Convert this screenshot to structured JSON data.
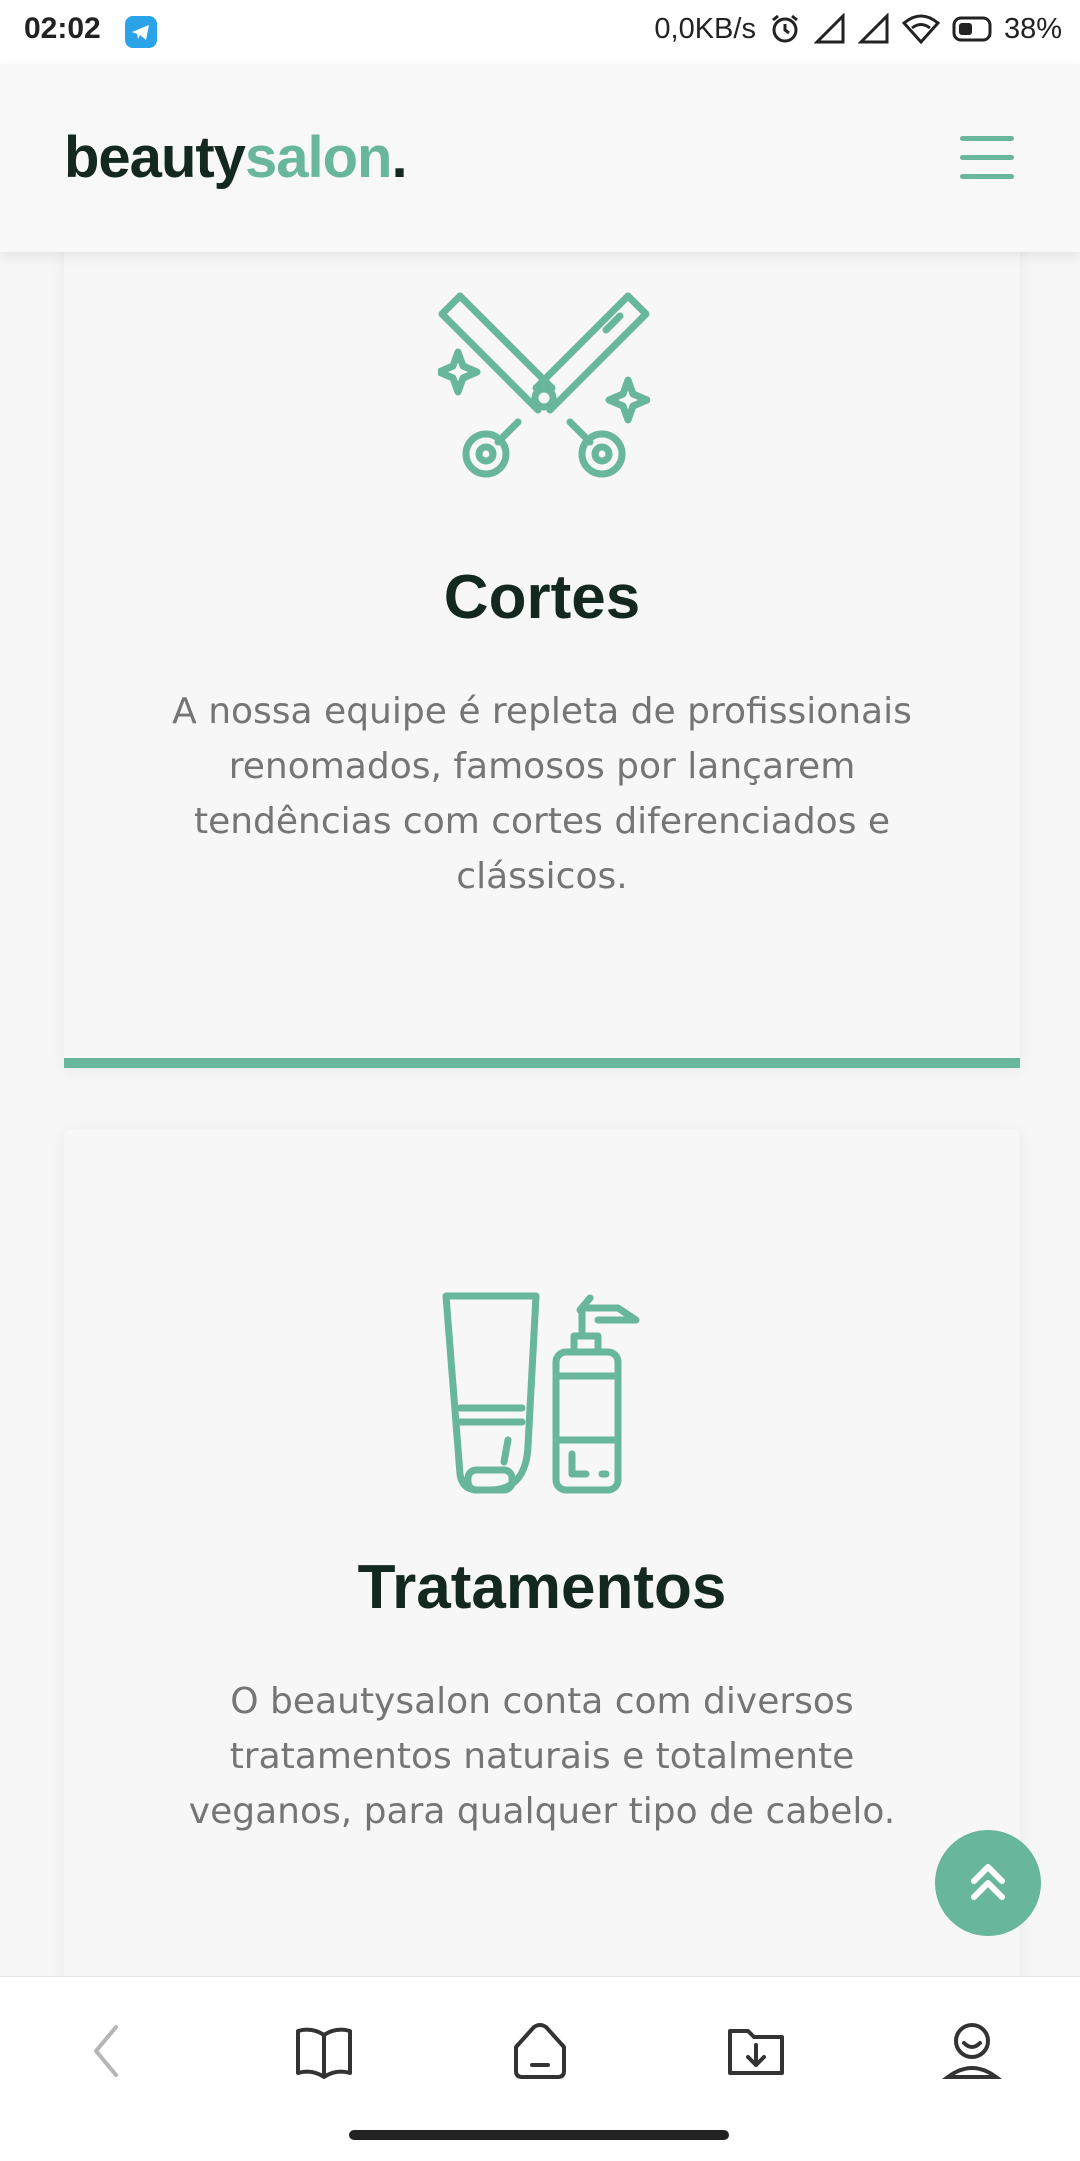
{
  "status_bar": {
    "time": "02:02",
    "net_speed": "0,0KB/s",
    "battery": "38%",
    "icons": [
      "telegram-icon",
      "alarm-icon",
      "signal-icon",
      "signal-icon",
      "wifi-icon",
      "battery-icon"
    ]
  },
  "header": {
    "logo_part1": "beauty",
    "logo_part2": "salon",
    "logo_part3": ".",
    "menu_icon": "hamburger-menu-icon"
  },
  "cards": [
    {
      "icon": "scissors-icon",
      "title": "Cortes",
      "text": "A nossa equipe é repleta de profissionais renomados, famosos por lançarem tendências com cortes diferenciados e clássicos."
    },
    {
      "icon": "hair-products-icon",
      "title": "Tratamentos",
      "text": "O beautysalon conta com diversos tratamentos naturais e totalmente veganos, para qualquer tipo de cabelo."
    }
  ],
  "scroll_top_icon": "double-chevron-up-icon",
  "bottom_nav": [
    "back-icon",
    "bookmarks-icon",
    "home-icon",
    "downloads-icon",
    "profile-icon"
  ],
  "colors": {
    "accent": "#68b69b",
    "dark": "#13281f",
    "body_text": "#757575",
    "background": "#f6f6f6"
  }
}
